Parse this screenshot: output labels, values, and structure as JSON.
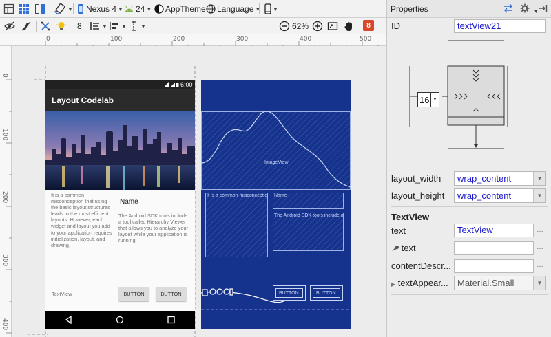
{
  "toolbar": {
    "device": "Nexus 4",
    "api": "24",
    "theme": "AppTheme",
    "language": "Language",
    "default_margin": "8",
    "zoom": "62%",
    "warnings_count": "8"
  },
  "ruler": {
    "h": [
      "0",
      "100",
      "200",
      "300",
      "400",
      "500"
    ],
    "v": [
      "0",
      "100",
      "200",
      "300",
      "400"
    ]
  },
  "phone": {
    "time": "6:00",
    "app_title": "Layout Codelab",
    "body_text": "It is a common misconception that using the basic layout structures leads to the most efficient layouts. However, each widget and layout you add to your application requires initialization, layout, and drawing.",
    "name_label": "Name",
    "sdk_text": "The Android SDK tools include a tool called Hierarchy Viewer that allows you to analyze your layout while your application is running.",
    "textview_label": "TextView",
    "button1": "BUTTON",
    "button2": "BUTTON"
  },
  "blueprint": {
    "imageview_label": "ImageView",
    "text1": "It is a common misconceptio",
    "name": "Name",
    "text2": "The Android SDK tools include a",
    "button1": "BUTTON",
    "button2": "BUTTON"
  },
  "properties": {
    "title": "Properties",
    "id_label": "ID",
    "id_value": "textView21",
    "margin_value": "16",
    "layout_width_label": "layout_width",
    "layout_width_value": "wrap_content",
    "layout_height_label": "layout_height",
    "layout_height_value": "wrap_content",
    "section": "TextView",
    "text_label": "text",
    "text_value": "TextView",
    "tools_text_label": "text",
    "content_desc_label": "contentDescr...",
    "text_appearance_label": "textAppear...",
    "text_appearance_value": "Material.Small"
  },
  "colors": {
    "blueprint_bg": "#15328d",
    "accent_blue": "#1a1acc",
    "warning_badge": "#d9472b"
  }
}
